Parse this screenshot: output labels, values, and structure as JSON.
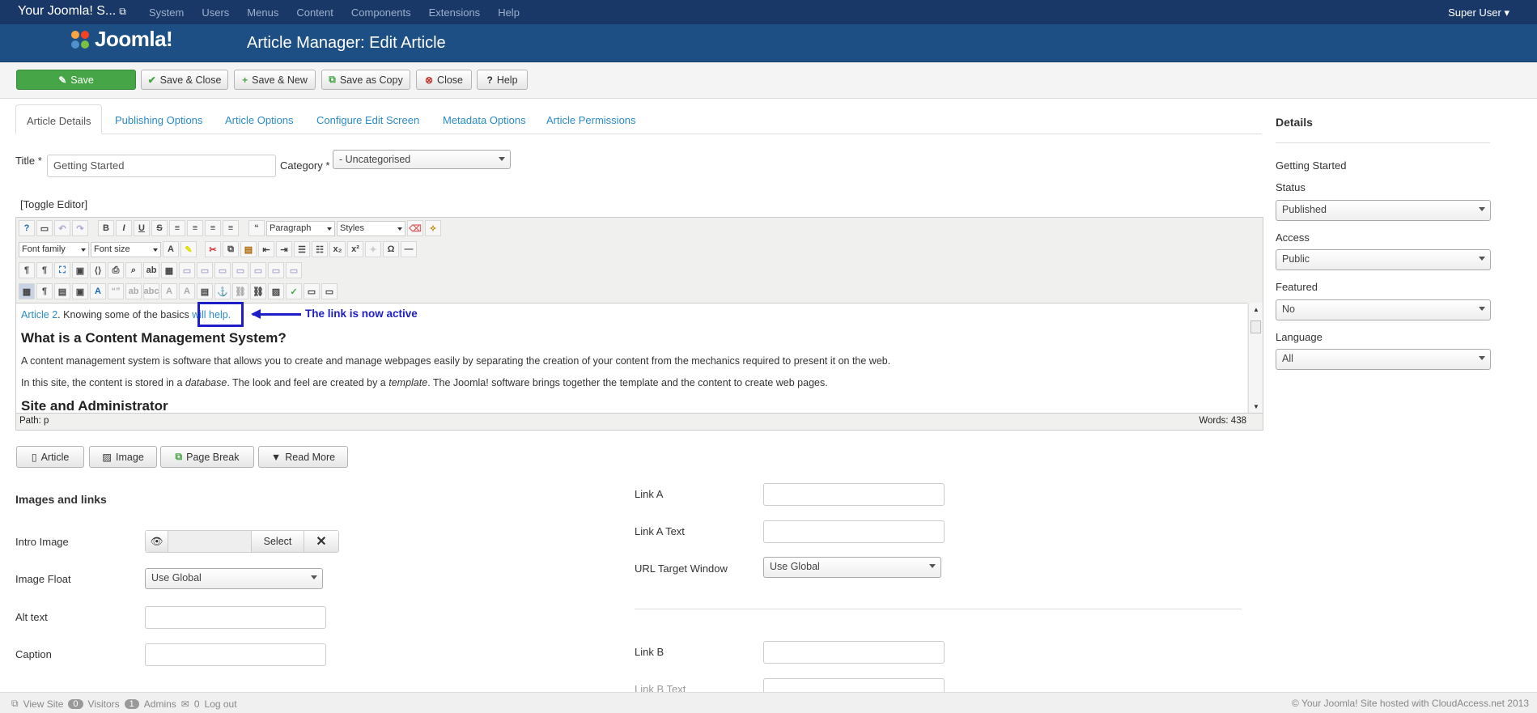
{
  "topnav": {
    "site_name": "Your Joomla! S...",
    "menu": [
      "System",
      "Users",
      "Menus",
      "Content",
      "Components",
      "Extensions",
      "Help"
    ],
    "user": "Super User"
  },
  "header": {
    "logo_text": "Joomla!",
    "title": "Article Manager: Edit Article"
  },
  "toolbar": {
    "save": "Save",
    "save_close": "Save & Close",
    "save_new": "Save & New",
    "save_copy": "Save as Copy",
    "close": "Close",
    "help": "Help"
  },
  "tabs": [
    "Article Details",
    "Publishing Options",
    "Article Options",
    "Configure Edit Screen",
    "Metadata Options",
    "Article Permissions"
  ],
  "form": {
    "title_label": "Title *",
    "title_value": "Getting Started",
    "category_label": "Category *",
    "category_value": "- Uncategorised",
    "toggle_editor": "[Toggle Editor]"
  },
  "editor": {
    "paragraph": "Paragraph",
    "styles": "Styles",
    "font_family": "Font family",
    "font_size": "Font size",
    "link1": "Article 2",
    "text1": ". Knowing some of the basics ",
    "link2": "will help.",
    "heading1": "What is a Content Management System?",
    "para1": "A content management system is software that allows you to create and manage webpages easily by separating the creation of your content from the mechanics required to present it on the web.",
    "para2_a": "In this site, the content is stored in a ",
    "para2_b": "database",
    "para2_c": ". The look and feel are created by a ",
    "para2_d": "template",
    "para2_e": ". The Joomla! software brings together the template and the content to create web pages.",
    "heading2": "Site and Administrator",
    "path": "Path:  p",
    "words": "Words: 438"
  },
  "annotation": "The link is now active",
  "editor_buttons": [
    "Article",
    "Image",
    "Page Break",
    "Read More"
  ],
  "images_links": {
    "section_title": "Images and links",
    "intro_image": "Intro Image",
    "select": "Select",
    "image_float": "Image Float",
    "image_float_value": "Use Global",
    "alt_text": "Alt text",
    "caption": "Caption",
    "link_a": "Link A",
    "link_a_text": "Link A Text",
    "url_target": "URL Target Window",
    "url_target_value": "Use Global",
    "link_b": "Link B",
    "link_b_text": "Link B Text"
  },
  "sidebar": {
    "title": "Details",
    "article_title": "Getting Started",
    "status_label": "Status",
    "status_value": "Published",
    "access_label": "Access",
    "access_value": "Public",
    "featured_label": "Featured",
    "featured_value": "No",
    "language_label": "Language",
    "language_value": "All"
  },
  "statusbar": {
    "view_site": "View Site",
    "visitors_count": "0",
    "visitors": "Visitors",
    "admins_count": "1",
    "admins": "Admins",
    "logout_count": "0",
    "logout": "Log out",
    "copyright": "© Your Joomla! Site hosted with CloudAccess.net 2013"
  },
  "colors": {
    "nav": "#1a3867",
    "header": "#1d4f85",
    "save": "#46a546",
    "link": "#2a8bc6",
    "annotation": "#1d1ec8"
  }
}
